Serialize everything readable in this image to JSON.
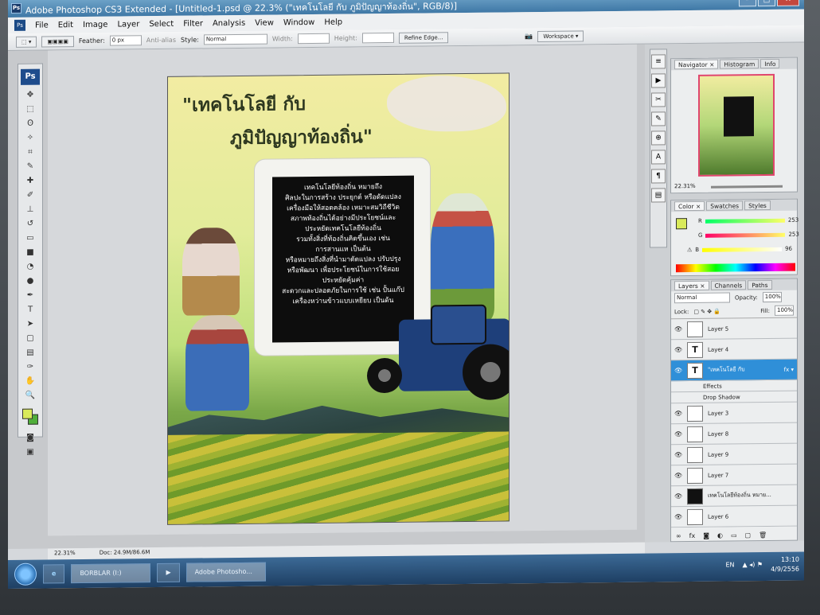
{
  "window": {
    "title": "Adobe Photoshop CS3 Extended - [Untitled-1.psd @ 22.3% (\"เทคโนโลยี กับ        ภูมิปัญญาท้องถิ่น\", RGB/8)]"
  },
  "menu": [
    "File",
    "Edit",
    "Image",
    "Layer",
    "Select",
    "Filter",
    "Analysis",
    "View",
    "Window",
    "Help"
  ],
  "options": {
    "feather_label": "Feather:",
    "feather_value": "0 px",
    "antialias": "Anti-alias",
    "style_label": "Style:",
    "style_value": "Normal",
    "width_label": "Width:",
    "height_label": "Height:",
    "refine_edge": "Refine Edge...",
    "workspace": "Workspace ▾"
  },
  "poster": {
    "title_line1": "\"เทคโนโลยี กับ",
    "title_line2": "ภูมิปัญญาท้องถิ่น\"",
    "body": [
      "เทคโนโลยีท้องถิ่น   หมายถึง",
      "ศิลปะในการสร้าง ประยุกต์ หรือดัดแปลง",
      "เครื่องมือให้สอดคล้อง เหมาะสมวิถีชีวิต",
      "สภาพท้องถิ่นได้อย่างมีประโยชน์และ",
      "ประหยัดเทคโนโลยีท้องถิ่น",
      "รวมทั้งสิ่งที่ท้องถิ่นคิดขึ้นเอง เช่น",
      "การสานแห เป็นต้น",
      "หรือหมายถึงสิ่งที่นำมาดัดแปลง ปรับปรุง",
      "หรือพัฒนา เพื่อประโยชน์ในการใช้สอย",
      "ประหยัดคุ้มค่า",
      "สะดวกและปลอดภัยในการใช้ เช่น ปั้นแก๊ป",
      "เครื่องหว่านข้าวแบบเหยียบ เป็นต้น"
    ]
  },
  "navigator": {
    "tabs": [
      "Navigator ×",
      "Histogram",
      "Info"
    ],
    "zoom": "22.31%"
  },
  "color": {
    "tabs": [
      "Color ×",
      "Swatches",
      "Styles"
    ],
    "r_label": "R",
    "r": "253",
    "g_label": "G",
    "g": "253",
    "b_label": "B",
    "b": "96"
  },
  "layers": {
    "tabs": [
      "Layers ×",
      "Channels",
      "Paths"
    ],
    "blend": "Normal",
    "opacity_label": "Opacity:",
    "opacity": "100%",
    "lock_label": "Lock:",
    "fill_label": "Fill:",
    "fill": "100%",
    "items": [
      {
        "name": "Layer 5",
        "thumb": ""
      },
      {
        "name": "Layer 4",
        "thumb": "T"
      },
      {
        "name": "\"เทคโนโลยี กับ",
        "thumb": "T"
      },
      {
        "name": "Effects",
        "thumb": ""
      },
      {
        "name": "Drop Shadow",
        "thumb": ""
      },
      {
        "name": "Layer 3",
        "thumb": ""
      },
      {
        "name": "Layer 8",
        "thumb": ""
      },
      {
        "name": "Layer 9",
        "thumb": ""
      },
      {
        "name": "Layer 7",
        "thumb": ""
      },
      {
        "name": "เทคโนโลยีท้องถิ่น  หมาย...",
        "thumb": ""
      },
      {
        "name": "Layer 6",
        "thumb": ""
      }
    ]
  },
  "status": {
    "zoom": "22.31%",
    "doc": "Doc: 24.9M/86.6M"
  },
  "taskbar": {
    "item1": "BORBLAR (I:)",
    "item2": "Adobe Photosho...",
    "lang": "EN",
    "time": "13:10",
    "date": "4/9/2556"
  },
  "colors": {
    "accent_layer": "#2f8fd8",
    "title_bar": "#3f78a6",
    "fg_color": "#d9ea5a"
  }
}
